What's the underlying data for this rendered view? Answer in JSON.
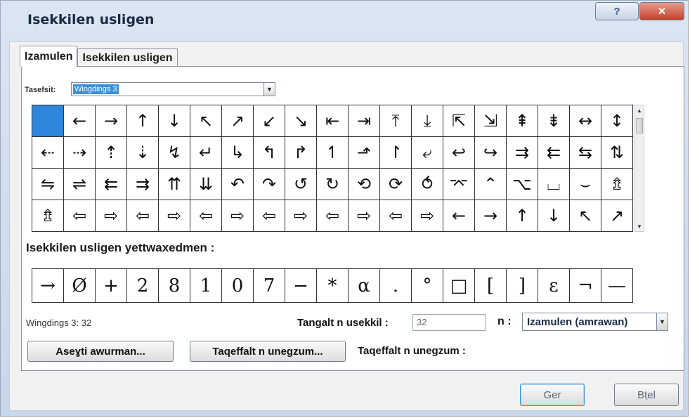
{
  "window": {
    "title": "Isekkilen usligen",
    "help_glyph": "?",
    "close_glyph": "✕"
  },
  "tabs": [
    {
      "label": "Izamulen",
      "active": true
    },
    {
      "label": "Isekkilen usligen",
      "active": false
    }
  ],
  "font_picker": {
    "label": "Tasefsit:",
    "value": "Wingdings 3"
  },
  "symbol_grid": {
    "rows": [
      [
        "",
        "←",
        "→",
        "↑",
        "↓",
        "↖",
        "↗",
        "↙",
        "↘",
        "⇤",
        "⇥",
        "⤒",
        "⤓",
        "⇱",
        "⇲",
        "⇞",
        "⇟",
        "↔",
        "↕"
      ],
      [
        "⇠",
        "⇢",
        "⇡",
        "⇣",
        "↯",
        "↵",
        "↳",
        "↰",
        "↱",
        "↿",
        "⬏",
        "↾",
        "⤶",
        "↩",
        "↪",
        "⇉",
        "⇇",
        "⇆",
        "⇅"
      ],
      [
        "⇋",
        "⇌",
        "⇇",
        "⇉",
        "⇈",
        "⇊",
        "↶",
        "↷",
        "↺",
        "↻",
        "⟲",
        "⟳",
        "⥀",
        "⌤",
        "⌃",
        "⌥",
        "⌴",
        "⌣",
        "⇯"
      ],
      [
        "⇯",
        "⇦",
        "⇨",
        "⇦",
        "⇨",
        "⇦",
        "⇨",
        "⇦",
        "⇨",
        "⇦",
        "⇨",
        "⇦",
        "⇨",
        "←",
        "→",
        "↑",
        "↓",
        "↖",
        "↗"
      ]
    ]
  },
  "recent": {
    "label": "Isekkilen usligen yettwaxedmen :",
    "items": [
      "→",
      "Ø",
      "+",
      "2",
      "8",
      "1",
      "0",
      "7",
      "−",
      "*",
      "α",
      ".",
      "°",
      "□",
      "[",
      "]",
      "ε",
      "¬",
      "—"
    ]
  },
  "status": {
    "font_info": "Wingdings 3: 32",
    "char_code_label": "Tangalt n usekkil :",
    "char_code_value": "32",
    "from_label": "n :",
    "from_value": "Izamulen (amrawan)"
  },
  "buttons": {
    "autocorrect": "Aseɣti awurman...",
    "shortcut_key": "Taqeffalt n unegzum...",
    "shortcut_label": "Taqeffalt n unegzum :",
    "ok": "Ger",
    "cancel": "Bṭel"
  },
  "colors": {
    "selection": "#2f87dd",
    "close_button": "#c4422a"
  }
}
